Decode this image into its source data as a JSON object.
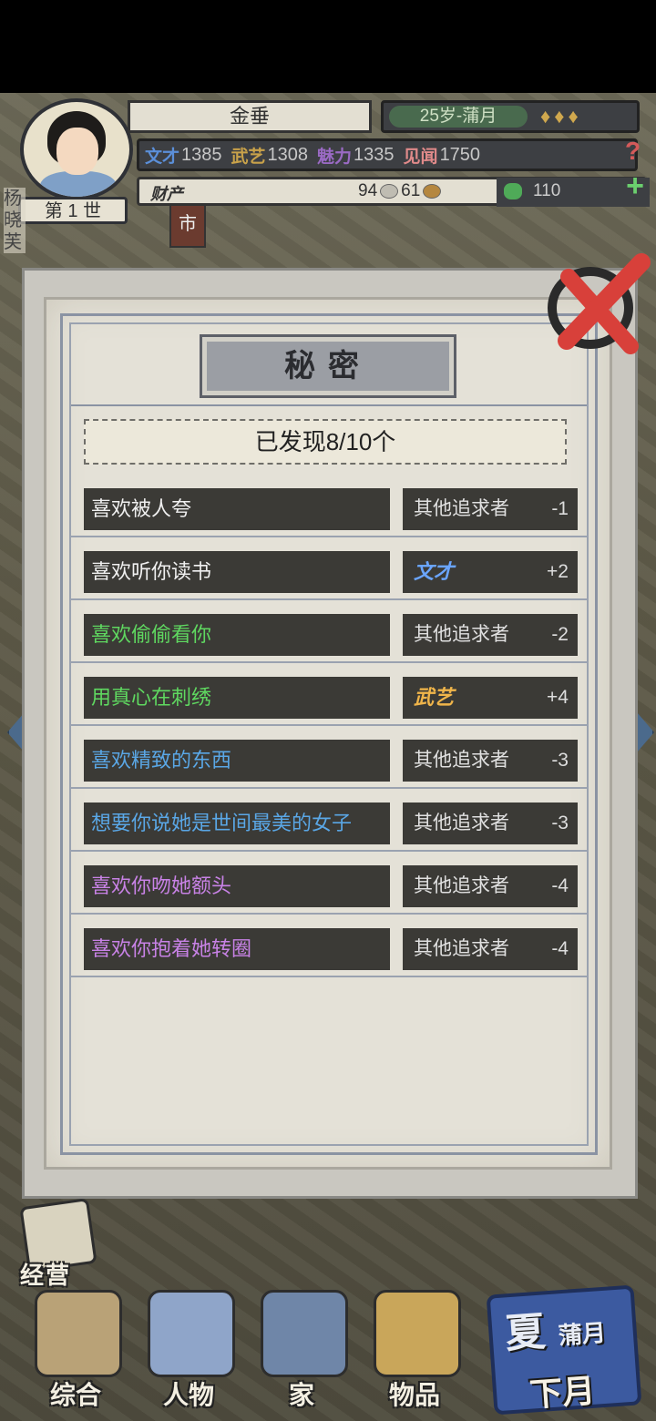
{
  "header": {
    "name": "金垂",
    "generation": "第 1 世",
    "age": "25岁-蒲月",
    "stats": [
      {
        "label": "文才",
        "value": "1385",
        "color": "#5b8fd9"
      },
      {
        "label": "武艺",
        "value": "1308",
        "color": "#c9a24a"
      },
      {
        "label": "魅力",
        "value": "1335",
        "color": "#9a6ac4"
      },
      {
        "label": "见闻",
        "value": "1750",
        "color": "#e08a8a"
      }
    ],
    "money_label": "财产",
    "silver": "94",
    "gold": "61",
    "jade": "110",
    "side_glyphs": "杨晓芙",
    "market_sign": "市"
  },
  "modal": {
    "title": "秘密",
    "discovered": "已发现8/10个",
    "secrets": [
      {
        "text": "喜欢被人夸",
        "color": "#f0f0f0",
        "effect": "其他追求者",
        "effect_type": "plain",
        "effect_color": "#e0e0e0",
        "value": "-1"
      },
      {
        "text": "喜欢听你读书",
        "color": "#f0f0f0",
        "effect": "文才",
        "effect_type": "tag",
        "effect_color": "#6aa5ff",
        "value": "+2"
      },
      {
        "text": "喜欢偷偷看你",
        "color": "#5fd860",
        "effect": "其他追求者",
        "effect_type": "plain",
        "effect_color": "#e0e0e0",
        "value": "-2"
      },
      {
        "text": "用真心在刺绣",
        "color": "#5fd860",
        "effect": "武艺",
        "effect_type": "tag",
        "effect_color": "#f0b54a",
        "value": "+4"
      },
      {
        "text": "喜欢精致的东西",
        "color": "#5aa7e6",
        "effect": "其他追求者",
        "effect_type": "plain",
        "effect_color": "#e0e0e0",
        "value": "-3"
      },
      {
        "text": "想要你说她是世间最美的女子",
        "color": "#5aa7e6",
        "effect": "其他追求者",
        "effect_type": "plain",
        "effect_color": "#e0e0e0",
        "value": "-3"
      },
      {
        "text": "喜欢你吻她额头",
        "color": "#c882e6",
        "effect": "其他追求者",
        "effect_type": "plain",
        "effect_color": "#e0e0e0",
        "value": "-4"
      },
      {
        "text": "喜欢你抱着她转圈",
        "color": "#c882e6",
        "effect": "其他追求者",
        "effect_type": "plain",
        "effect_color": "#e0e0e0",
        "value": "-4"
      }
    ]
  },
  "nav": {
    "manage": "经营",
    "items": [
      {
        "label": "综合",
        "icon_color": "#b9a277",
        "name": "nav-general"
      },
      {
        "label": "人物",
        "icon_color": "#8fa5c9",
        "name": "nav-characters"
      },
      {
        "label": "家",
        "icon_color": "#6f86a8",
        "name": "nav-home"
      },
      {
        "label": "物品",
        "icon_color": "#c9a65a",
        "name": "nav-items"
      }
    ],
    "season": "夏",
    "month": "蒲月",
    "next_month": "下月"
  }
}
